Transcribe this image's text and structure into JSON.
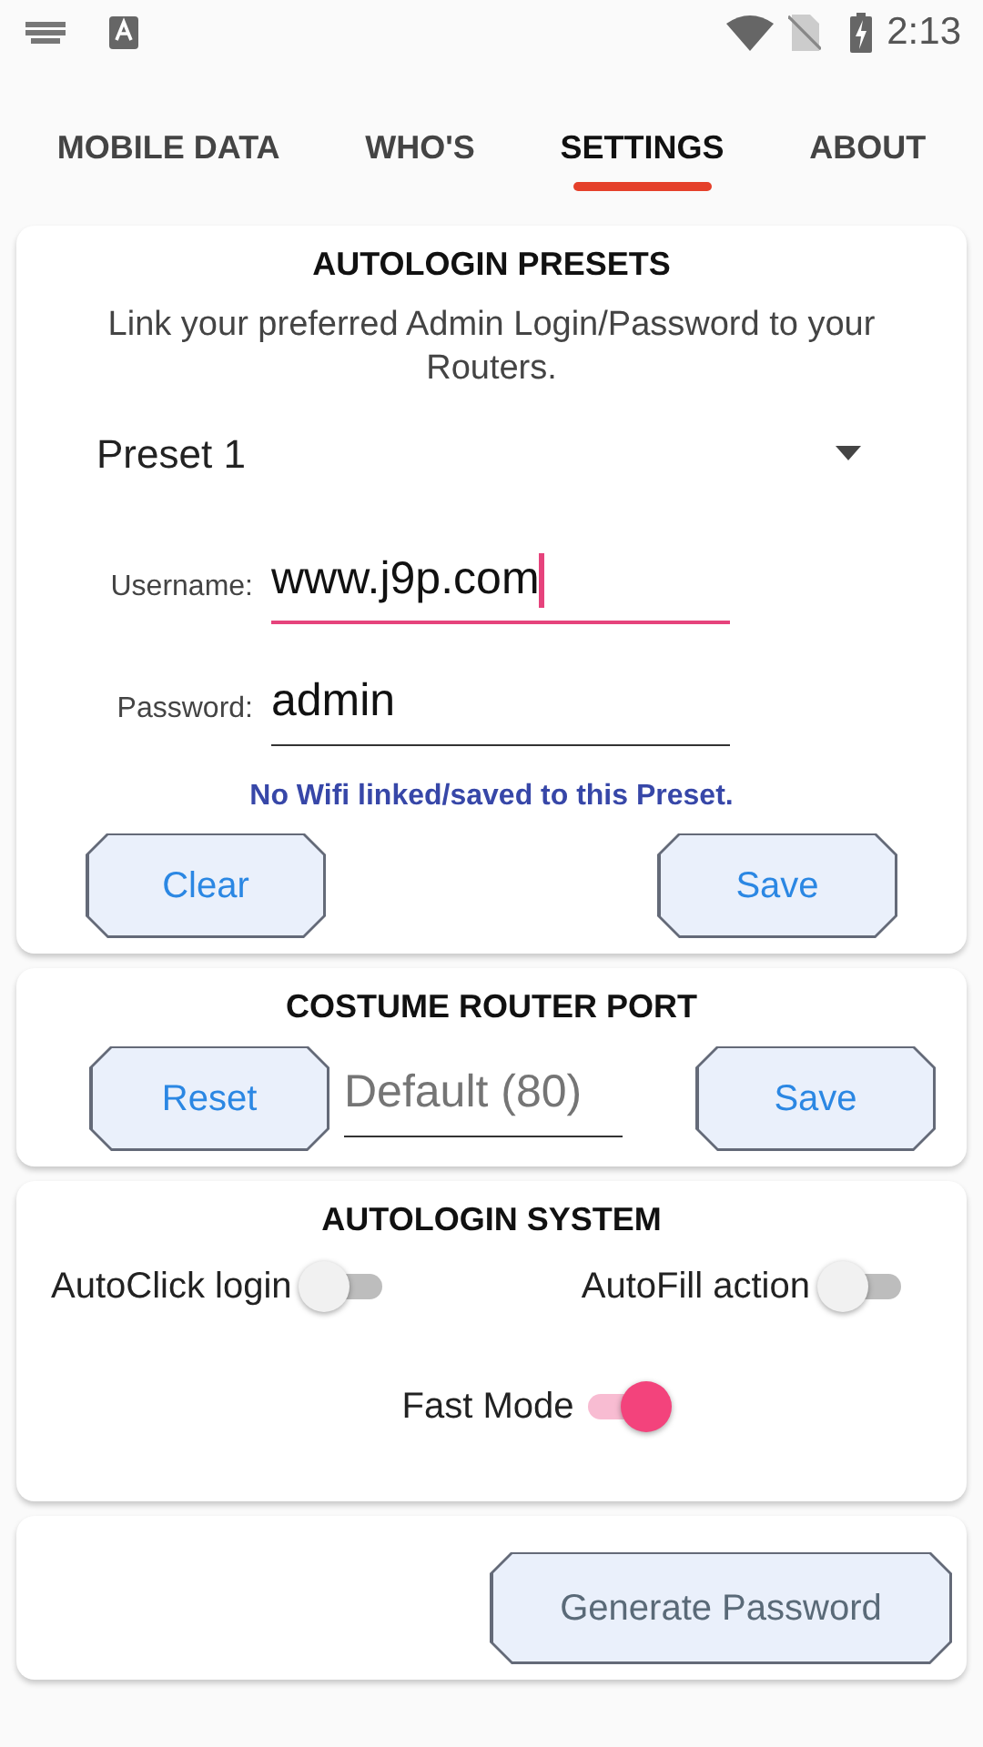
{
  "status_bar": {
    "time": "2:13"
  },
  "tabs": [
    {
      "label": "MOBILE DATA",
      "selected": false
    },
    {
      "label": "WHO'S",
      "selected": false
    },
    {
      "label": "SETTINGS",
      "selected": true
    },
    {
      "label": "ABOUT",
      "selected": false
    }
  ],
  "presets_card": {
    "title": "AUTOLOGIN PRESETS",
    "description": "Link your preferred Admin Login/Password to your Routers.",
    "preset": "Preset 1",
    "fields": [
      {
        "label": "Username:",
        "value": "www.j9p.com",
        "focused": true
      },
      {
        "label": "Password:",
        "value": "admin",
        "focused": false
      }
    ],
    "notice": "No Wifi linked/saved to this Preset.",
    "buttons": [
      "Clear",
      "Save"
    ]
  },
  "port_card": {
    "title": "COSTUME ROUTER PORT",
    "buttons": [
      "Reset",
      "Save"
    ],
    "placeholder": "Default (80)"
  },
  "system_card": {
    "title": "AUTOLOGIN SYSTEM",
    "switches": [
      {
        "label": "AutoClick login",
        "on": false
      },
      {
        "label": "AutoFill action",
        "on": false
      },
      {
        "label": "Fast Mode",
        "on": true
      }
    ]
  },
  "generate_button": "Generate Password"
}
